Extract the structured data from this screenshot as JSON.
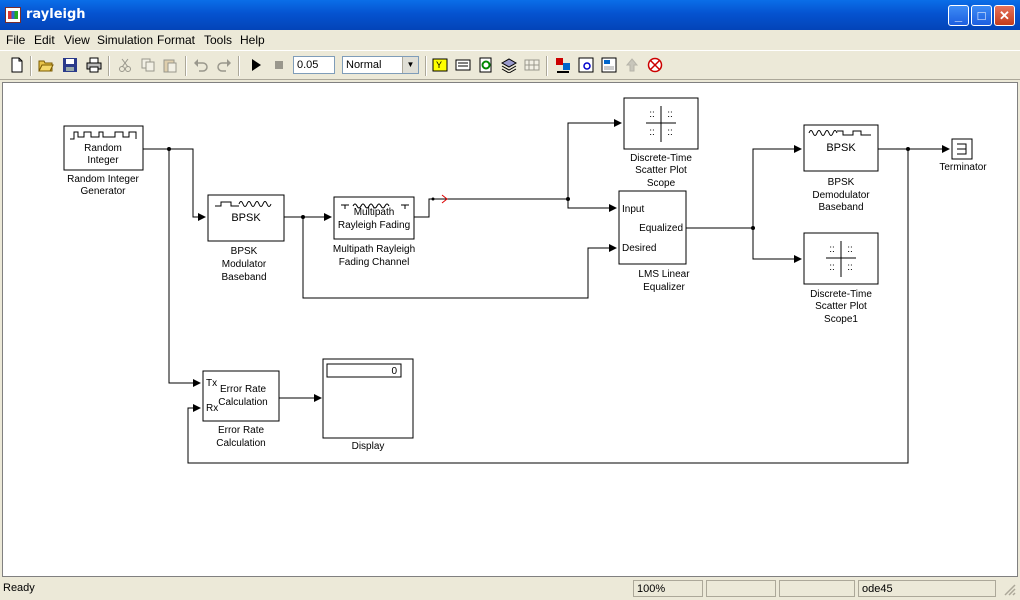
{
  "window": {
    "title": "rayleigh"
  },
  "menu": [
    "File",
    "Edit",
    "View",
    "Simulation",
    "Format",
    "Tools",
    "Help"
  ],
  "toolbar": {
    "stop_time": "0.05",
    "sim_mode": "Normal"
  },
  "blocks": {
    "random_int": {
      "face": [
        "Random",
        "Integer"
      ],
      "label": [
        "Random Integer",
        "Generator"
      ]
    },
    "bpsk_mod": {
      "face": "BPSK",
      "label": [
        "BPSK",
        "Modulator",
        "Baseband"
      ]
    },
    "rayleigh": {
      "face": [
        "Multipath",
        "Rayleigh Fading"
      ],
      "label": [
        "Multipath Rayleigh",
        "Fading Channel"
      ]
    },
    "scope_top": {
      "label": [
        "Discrete-Time",
        "Scatter Plot",
        "Scope"
      ]
    },
    "lms": {
      "ports": [
        "Input",
        "Desired",
        "Equalized"
      ],
      "label": [
        "LMS Linear",
        "Equalizer"
      ]
    },
    "bpsk_demod": {
      "face": "BPSK",
      "label": [
        "BPSK",
        "Demodulator",
        "Baseband"
      ]
    },
    "scope1": {
      "label": [
        "Discrete-Time",
        "Scatter Plot",
        "Scope1"
      ]
    },
    "terminator": {
      "label": "Terminator"
    },
    "error_rate": {
      "ports": [
        "Tx",
        "Rx"
      ],
      "face": [
        "Error Rate",
        "Calculation"
      ],
      "label": [
        "Error Rate",
        "Calculation"
      ]
    },
    "display": {
      "value": "0",
      "label": "Display"
    }
  },
  "status": {
    "text": "Ready",
    "zoom": "100%",
    "solver": "ode45"
  }
}
